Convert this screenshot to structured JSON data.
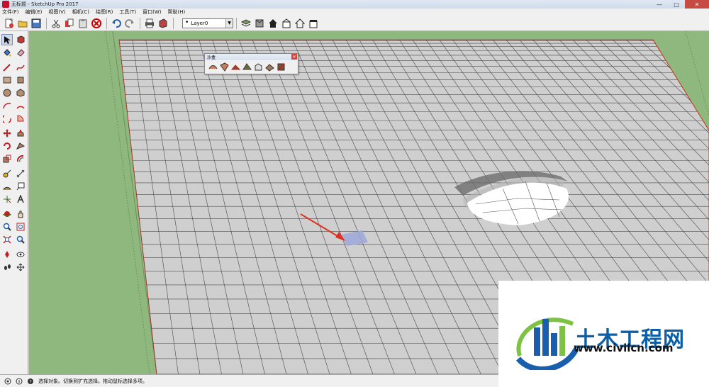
{
  "window": {
    "title": "无标题 - SketchUp Pro 2017"
  },
  "menu": {
    "items": [
      "文件(F)",
      "编辑(E)",
      "视图(V)",
      "相机(C)",
      "绘图(R)",
      "工具(T)",
      "窗口(W)",
      "帮助(H)"
    ]
  },
  "toolbar": {
    "layer_selected": "Layer0"
  },
  "sandbox_toolbar": {
    "title": "沙盒"
  },
  "status": {
    "text": "选择对象。切换到扩充选择。拖动鼠标选择多项。"
  },
  "watermark": {
    "brand": "土木工程网",
    "url": "www.civilcn.com"
  },
  "colors": {
    "ground": "#cfcfcf",
    "grass": "#8fb87e",
    "accent": "#e0301e",
    "brand": "#0b5fa8"
  }
}
